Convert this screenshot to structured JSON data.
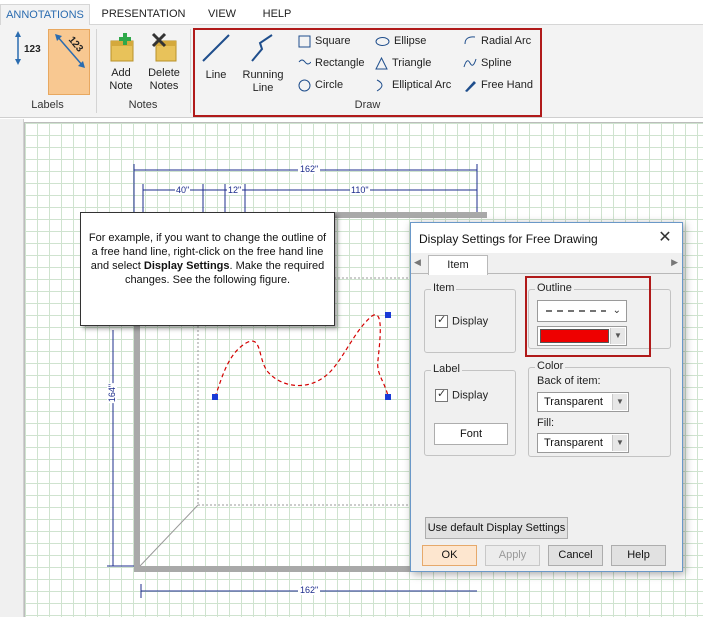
{
  "tabs": [
    "ANNOTATIONS",
    "PRESENTATION",
    "VIEW",
    "HELP"
  ],
  "ribbon": {
    "labels_group": {
      "title": "Labels",
      "vert_dim_text": "123",
      "diag_dim_text": "123"
    },
    "notes_group": {
      "title": "Notes",
      "add_note": "Add\nNote",
      "delete_notes": "Delete\nNotes"
    },
    "draw_group": {
      "title": "Draw",
      "line": "Line",
      "running_line": "Running\nLine",
      "square": "Square",
      "rectangle": "Rectangle",
      "circle": "Circle",
      "ellipse": "Ellipse",
      "triangle": "Triangle",
      "elliptical_arc": "Elliptical Arc",
      "radial_arc": "Radial Arc",
      "spline": "Spline",
      "free_hand": "Free Hand"
    }
  },
  "drawing": {
    "dim_top": "162\"",
    "dim_a": "40\"",
    "dim_b": "12\"",
    "dim_c": "110\"",
    "dim_left": "164\"",
    "dim_bottom": "162\""
  },
  "callout": {
    "line1": "For example, if you want to change the outline of a free hand line, right-click on the free hand line and select ",
    "bold1": "Display Settings",
    "line2": ". Make the required changes. See the following figure."
  },
  "dialog": {
    "title": "Display Settings for Free Drawing",
    "tab": "Item",
    "item_group": "Item",
    "item_display": "Display",
    "label_group": "Label",
    "label_display": "Display",
    "font_button": "Font",
    "outline_group": "Outline",
    "outline_color": "#ee0000",
    "color_group": "Color",
    "back_of_item_label": "Back of item:",
    "back_of_item_value": "Transparent",
    "fill_label": "Fill:",
    "fill_value": "Transparent",
    "use_default": "Use default Display Settings",
    "ok": "OK",
    "apply": "Apply",
    "cancel": "Cancel",
    "help": "Help"
  }
}
